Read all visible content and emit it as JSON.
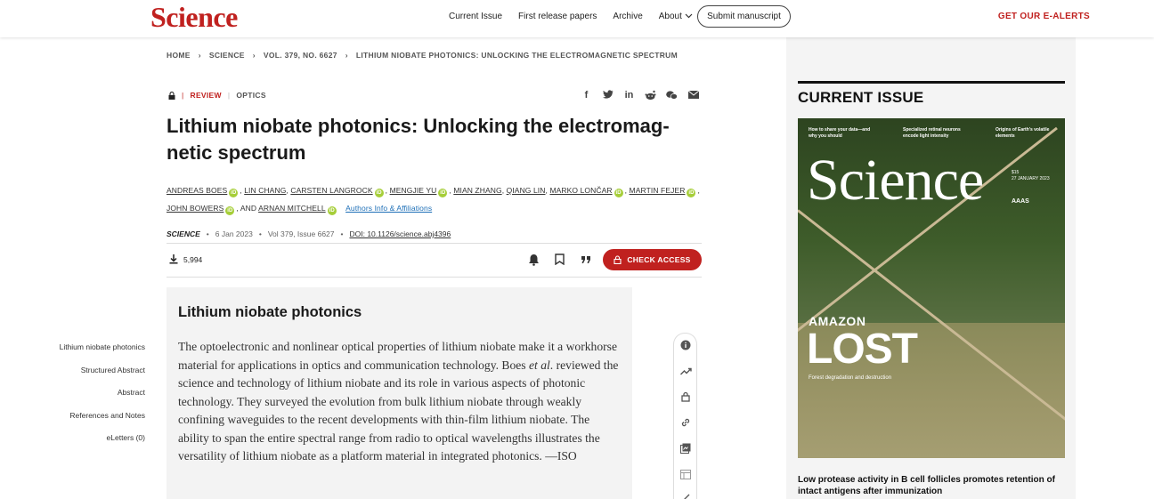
{
  "header": {
    "logo": "Science",
    "nav": [
      "Current Issue",
      "First release papers",
      "Archive",
      "About"
    ],
    "submit_label": "Submit manuscript",
    "ealerts_label": "GET OUR E-ALERTS"
  },
  "breadcrumb": [
    "HOME",
    "SCIENCE",
    "VOL. 379, NO. 6627",
    "LITHIUM NIOBATE PHOTONICS: UNLOCKING THE ELECTROMAGNETIC SPECTRUM"
  ],
  "article": {
    "type": "REVIEW",
    "category": "OPTICS",
    "title": "Lithium niobate photonics: Unlocking the electromag-netic spectrum",
    "authors": [
      "ANDREAS BOES",
      "LIN CHANG",
      "CARSTEN LANGROCK",
      "MENGJIE YU",
      "MIAN ZHANG",
      "QIANG LIN",
      "MARKO LONČAR",
      "MARTIN FEJER",
      "JOHN BOWERS",
      "ARNAN MITCHELL"
    ],
    "authors_and": ", AND",
    "affiliations_label": "Authors Info & Affiliations",
    "journal": "SCIENCE",
    "date": "6 Jan 2023",
    "volume": "Vol 379, Issue 6627",
    "doi": "DOI: 10.1126/science.abj4396",
    "downloads": "5,994",
    "check_access_label": "CHECK ACCESS"
  },
  "abstract": {
    "heading": "Lithium niobate photonics",
    "text_before": "The optoelectronic and nonlinear optical properties of lithium niobate make it a workhorse material for applications in optics and communication technology. Boes ",
    "text_em": "et al",
    "text_after": ". reviewed the science and technology of lithium niobate and its role in various aspects of photonic technology. They surveyed the evolution from bulk lithium niobate through weakly confining waveguides to the recent developments with thin-film lithium niobate. The ability to span the entire spectral range from radio to optical wavelengths illustrates the versatility of lithium niobate as a platform material in integrated photonics. —ISO"
  },
  "toc": [
    "Lithium niobate photonics",
    "Structured Abstract",
    "Abstract",
    "References and Notes",
    "eLetters (0)"
  ],
  "sidebar": {
    "current_issue_title": "CURRENT ISSUE",
    "cover": {
      "masthead": "Science",
      "teaser1": "How to share your data—and why you should",
      "teaser2": "Specialized retinal neurons encode light intensity",
      "teaser3": "Origins of Earth's volatile elements",
      "issue": "27 JANUARY 2023",
      "price": "$15",
      "publisher": "AAAS",
      "kicker": "AMAZON",
      "headline": "LOST",
      "subhead": "Forest degradation and destruction"
    },
    "headline": "Low protease activity in B cell follicles promotes retention of intact antigens after immunization"
  },
  "colors": {
    "brand_red": "#c0211f",
    "orcid_green": "#a6ce39",
    "link_blue": "#1d6fb7"
  }
}
